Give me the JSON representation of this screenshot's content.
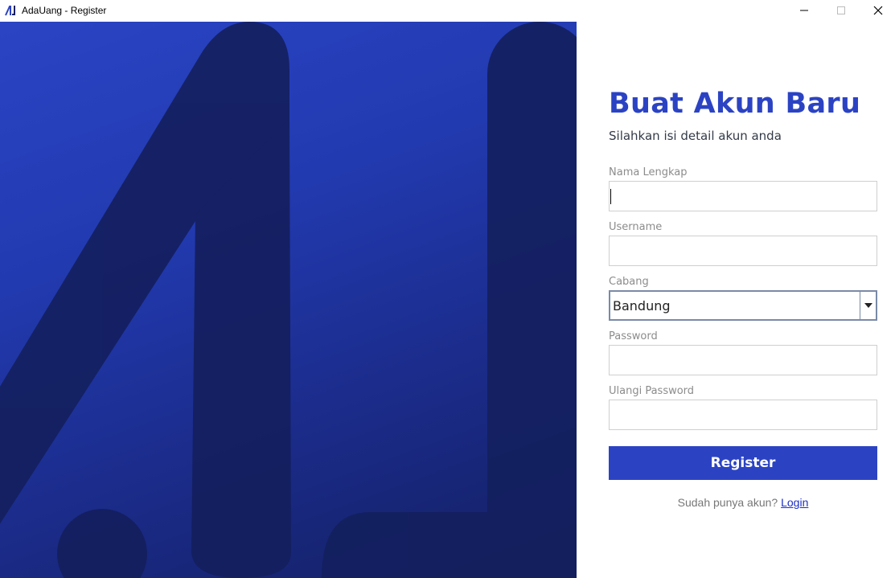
{
  "window": {
    "title": "AdaUang - Register",
    "logo_icon": "adauang-logo-icon",
    "minimize_icon": "minimize-icon",
    "maximize_icon": "maximize-icon",
    "close_icon": "close-icon"
  },
  "colors": {
    "brand": "#2b43c3",
    "hero_dark": "#141f62",
    "link": "#1a2fc4"
  },
  "form": {
    "heading": "Buat Akun Baru",
    "subheading": "Silahkan isi detail akun anda",
    "full_name": {
      "label": "Nama Lengkap",
      "value": ""
    },
    "username": {
      "label": "Username",
      "value": ""
    },
    "branch": {
      "label": "Cabang",
      "selected": "Bandung",
      "arrow_icon": "chevron-down-icon"
    },
    "password": {
      "label": "Password",
      "value": ""
    },
    "confirm_password": {
      "label": "Ulangi Password",
      "value": ""
    },
    "submit_label": "Register",
    "footer_text": "Sudah punya akun?",
    "login_link": "Login"
  }
}
